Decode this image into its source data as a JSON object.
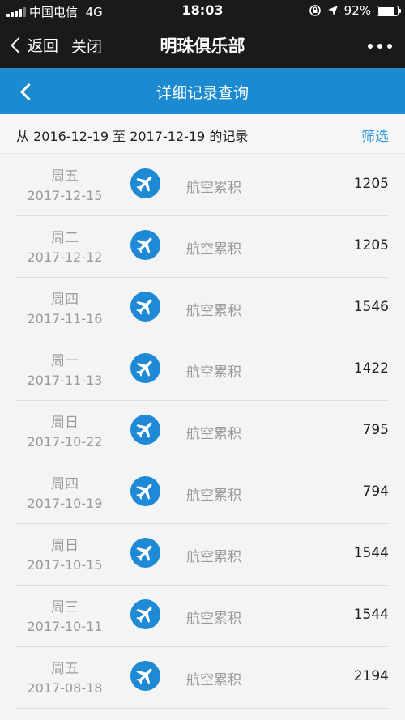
{
  "status_bar": {
    "carrier": "中国电信",
    "network": "4G",
    "time": "18:03",
    "battery": "92%",
    "battery_level": 0.92
  },
  "wechat_nav": {
    "back_label": "返回",
    "close_label": "关闭",
    "title": "明珠俱乐部"
  },
  "header": {
    "title": "详细记录查询"
  },
  "range": {
    "text": "从 2016-12-19 至 2017-12-19 的记录",
    "filter_label": "筛选"
  },
  "records": [
    {
      "weekday": "周五",
      "date": "2017-12-15",
      "type": "航空累积",
      "points": "1205"
    },
    {
      "weekday": "周二",
      "date": "2017-12-12",
      "type": "航空累积",
      "points": "1205"
    },
    {
      "weekday": "周四",
      "date": "2017-11-16",
      "type": "航空累积",
      "points": "1546"
    },
    {
      "weekday": "周一",
      "date": "2017-11-13",
      "type": "航空累积",
      "points": "1422"
    },
    {
      "weekday": "周日",
      "date": "2017-10-22",
      "type": "航空累积",
      "points": "795"
    },
    {
      "weekday": "周四",
      "date": "2017-10-19",
      "type": "航空累积",
      "points": "794"
    },
    {
      "weekday": "周日",
      "date": "2017-10-15",
      "type": "航空累积",
      "points": "1544"
    },
    {
      "weekday": "周三",
      "date": "2017-10-11",
      "type": "航空累积",
      "points": "1544"
    },
    {
      "weekday": "周五",
      "date": "2017-08-18",
      "type": "航空累积",
      "points": "2194"
    }
  ],
  "colors": {
    "app_header": "#1c8ad1",
    "plane_icon_bg": "#1e8ad6",
    "filter_link": "#3a9be0"
  }
}
